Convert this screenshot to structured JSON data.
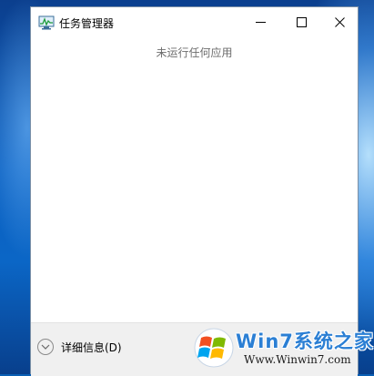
{
  "window": {
    "title": "任务管理器",
    "empty_message": "未运行任何应用"
  },
  "titlebar": {
    "minimize_icon": "minimize-icon",
    "maximize_icon": "maximize-icon",
    "close_icon": "close-icon"
  },
  "footer": {
    "details_label": "详细信息(D)"
  },
  "watermark": {
    "title": "Win7系统之家",
    "url": "Www.Winwin7.com"
  },
  "colors": {
    "desktop_blue": "#0a5fb4",
    "window_bg": "#ffffff",
    "footer_bg": "#f0f0f0",
    "watermark_blue": "#2b7fd4"
  }
}
